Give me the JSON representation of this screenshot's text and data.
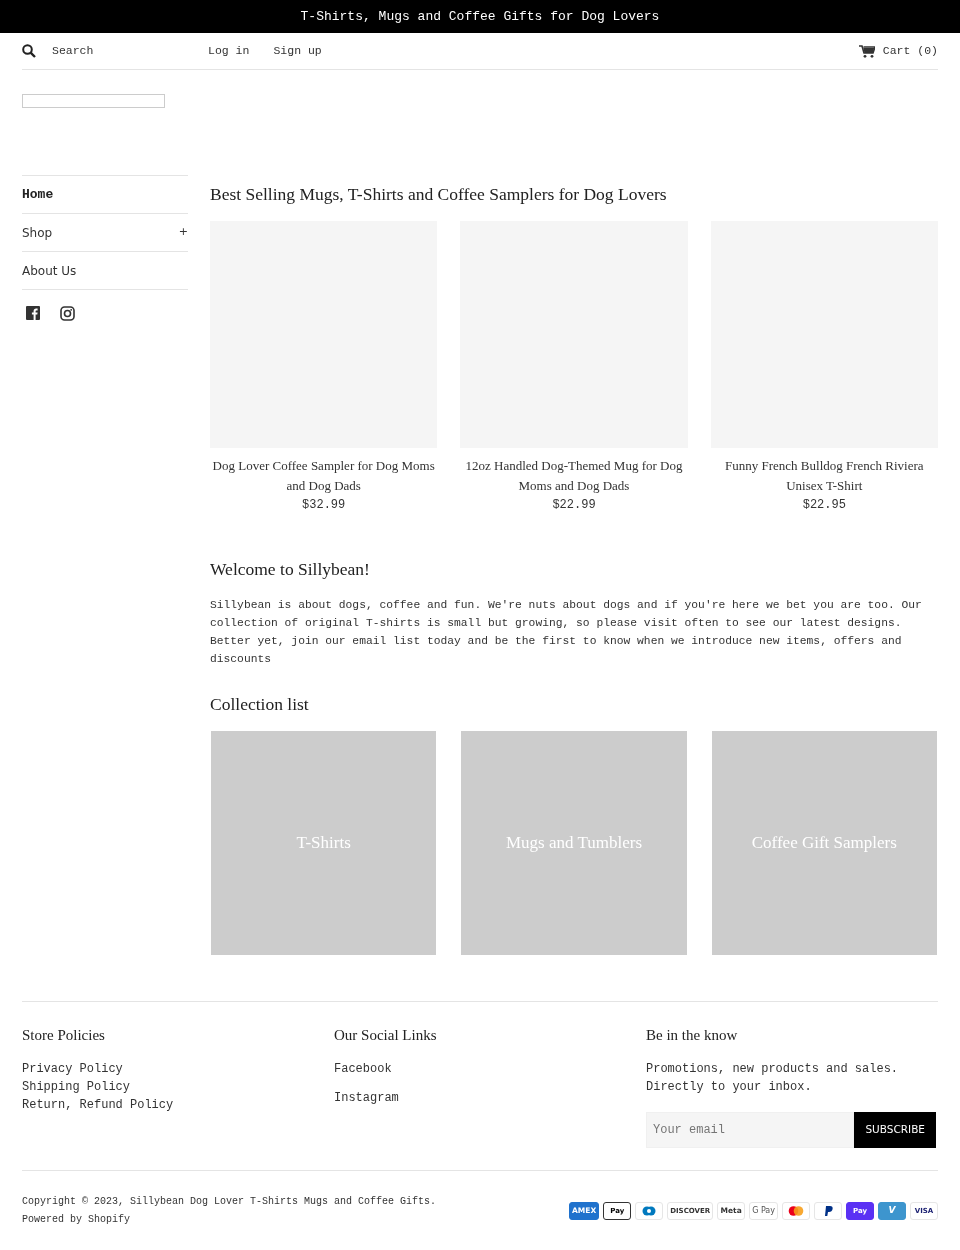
{
  "announcement": "T-Shirts, Mugs and Coffee Gifts for Dog Lovers",
  "header": {
    "search": {
      "placeholder": "Search"
    },
    "links": [
      "Log in",
      "Sign up"
    ],
    "cart": "Cart (0)"
  },
  "sidebar": {
    "items": [
      {
        "label": "Home",
        "selected": true
      },
      {
        "label": "Shop",
        "selected": false,
        "toggle": "+"
      },
      {
        "label": "About Us",
        "selected": false
      }
    ],
    "social": [
      {
        "kind": "facebook"
      },
      {
        "kind": "instagram"
      }
    ]
  },
  "featured": {
    "title": "Best Selling Mugs, T-Shirts and Coffee Samplers for Dog Lovers",
    "products": [
      {
        "name": "Dog Lover Coffee Sampler for Dog Moms and Dog Dads",
        "price": "$32.99"
      },
      {
        "name": "12oz Handled Dog-Themed Mug for Dog Moms and Dog Dads",
        "price": "$22.99"
      },
      {
        "name": "Funny French Bulldog French Riviera Unisex T-Shirt",
        "price": "$22.95"
      }
    ]
  },
  "welcome": {
    "title": "Welcome to Sillybean!",
    "text": "Sillybean is about dogs, coffee and fun. We're nuts about dogs and if you're here we bet you are too. Our collection of original T-shirts is small but growing, so please visit often to see our latest designs. Better yet, join our email list today and be the first to know when we introduce new items, offers and discounts"
  },
  "collections": {
    "title": "Collection list",
    "items": [
      "T-Shirts",
      "Mugs and Tumblers",
      "Coffee Gift Samplers"
    ]
  },
  "footer": {
    "columns": [
      {
        "title": "Store Policies",
        "kind": "links",
        "links": [
          "Privacy Policy",
          "Shipping Policy",
          "Return, Refund Policy"
        ]
      },
      {
        "title": "Our Social Links",
        "kind": "social",
        "links": [
          "Facebook",
          "Instagram"
        ]
      },
      {
        "title": "Be in the know",
        "kind": "newsletter",
        "text": "Promotions, new products and sales. Directly to your inbox.",
        "placeholder": "Your email",
        "button": "SUBSCRIBE"
      }
    ],
    "copyright": "Copyright © 2023, ",
    "store_link": "Sillybean Dog Lover T-Shirts Mugs and Coffee Gifts",
    "powered": ". Powered by Shopify",
    "payments": [
      {
        "kind": "amex",
        "label": "AMEX"
      },
      {
        "kind": "applepay",
        "label": "Pay"
      },
      {
        "kind": "diners"
      },
      {
        "kind": "discover",
        "label": "DISCOVER"
      },
      {
        "kind": "meta",
        "label": "Meta"
      },
      {
        "kind": "gpay",
        "label": "G Pay"
      },
      {
        "kind": "mastercard"
      },
      {
        "kind": "paypal"
      },
      {
        "kind": "shoppay",
        "label": "Pay"
      },
      {
        "kind": "venmo",
        "label": "V"
      },
      {
        "kind": "visa",
        "label": "VISA"
      }
    ]
  }
}
